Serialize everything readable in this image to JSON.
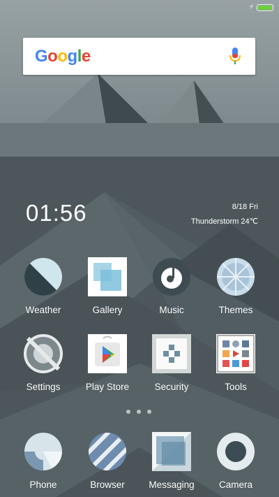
{
  "status_bar": {
    "battery_level": 1.0,
    "charging": true
  },
  "search": {
    "brand_label": "Google",
    "brand_colors": [
      "#4285F4",
      "#EA4335",
      "#FBBC05",
      "#4285F4",
      "#34A853",
      "#EA4335"
    ]
  },
  "clock_widget": {
    "time": "01:56",
    "date": "8/18 Fri",
    "weather": "Thunderstorm 24℃"
  },
  "apps": [
    {
      "label": "Weather",
      "icon": "weather-icon"
    },
    {
      "label": "Gallery",
      "icon": "gallery-icon"
    },
    {
      "label": "Music",
      "icon": "music-icon"
    },
    {
      "label": "Themes",
      "icon": "themes-icon"
    },
    {
      "label": "Settings",
      "icon": "settings-icon"
    },
    {
      "label": "Play Store",
      "icon": "play-store-icon"
    },
    {
      "label": "Security",
      "icon": "security-icon"
    },
    {
      "label": "Tools",
      "icon": "tools-folder-icon"
    }
  ],
  "page_indicator": {
    "pages": 3,
    "current": 1
  },
  "dock": [
    {
      "label": "Phone",
      "icon": "phone-icon"
    },
    {
      "label": "Browser",
      "icon": "browser-icon"
    },
    {
      "label": "Messaging",
      "icon": "messaging-icon"
    },
    {
      "label": "Camera",
      "icon": "camera-icon"
    }
  ]
}
